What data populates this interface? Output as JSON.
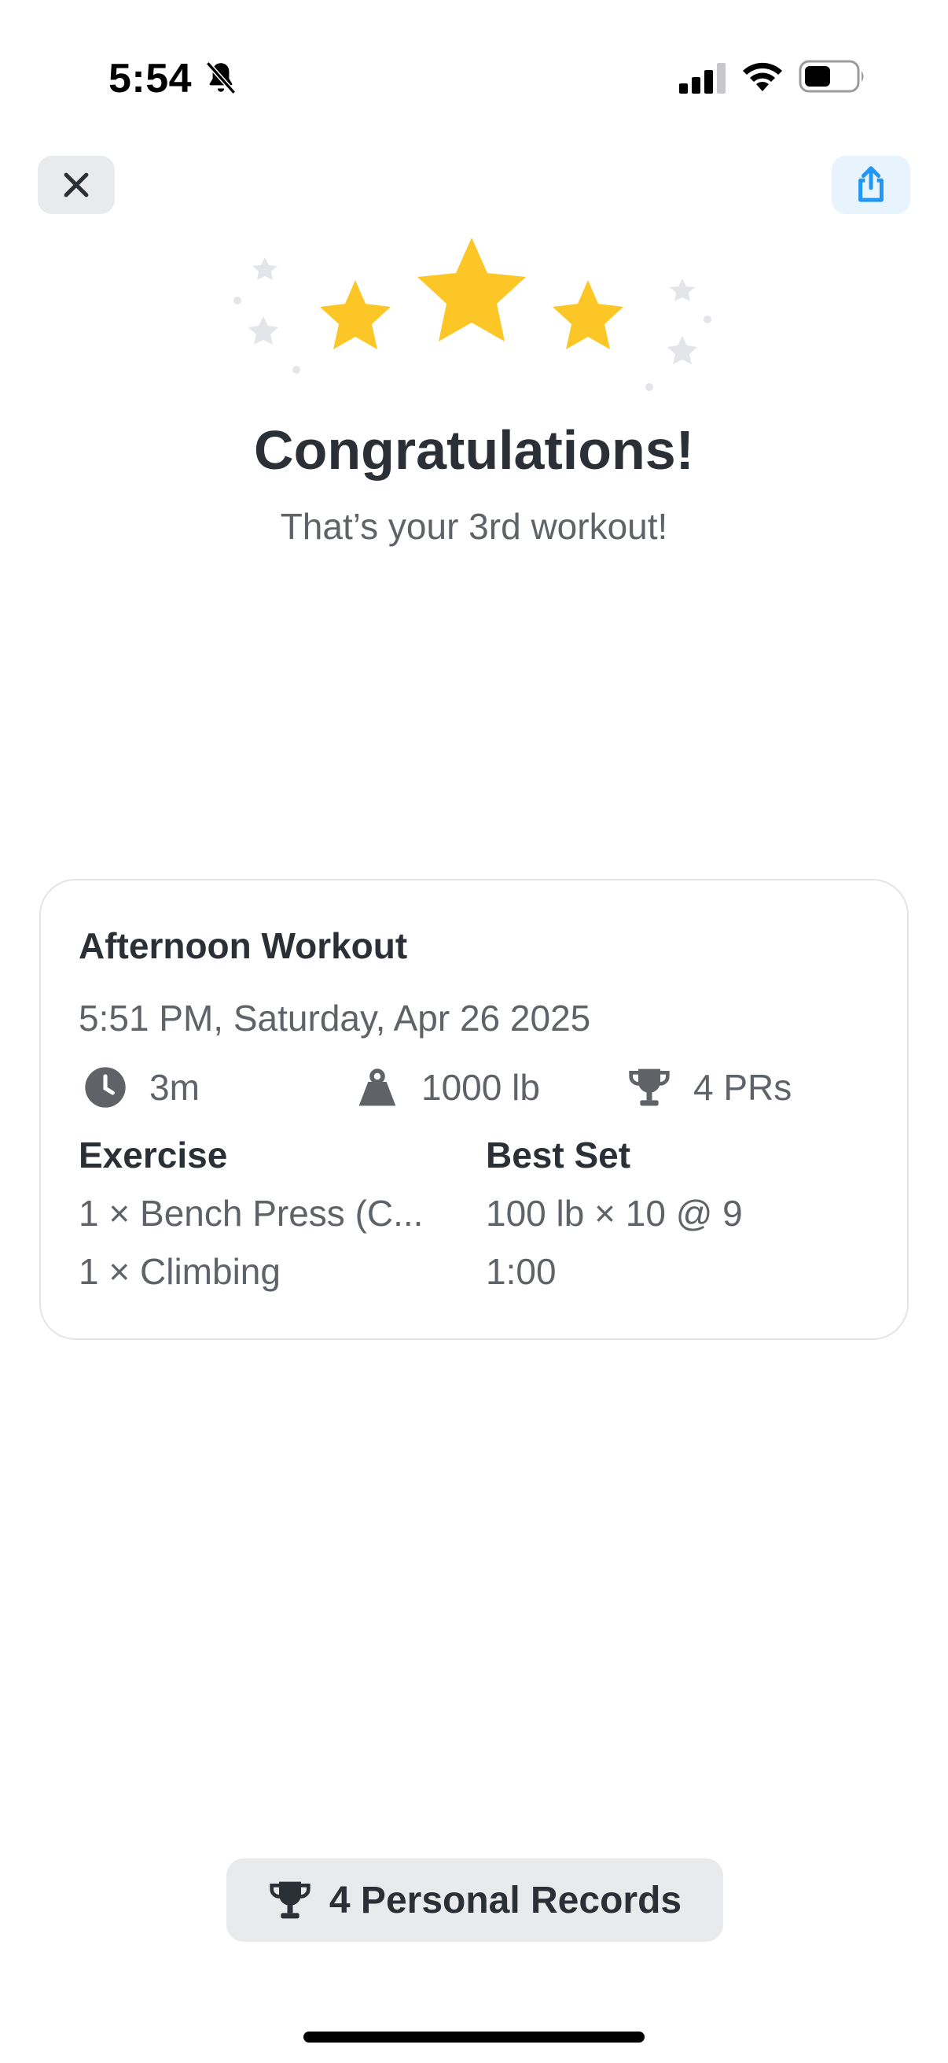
{
  "status_bar": {
    "time": "5:54",
    "icons": [
      "bell-slash-icon",
      "cellular-signal-icon",
      "wifi-icon",
      "battery-icon"
    ]
  },
  "toolbar": {
    "close_icon": "close-icon",
    "share_icon": "share-icon",
    "share_color": "#2196f3"
  },
  "header": {
    "title": "Congratulations!",
    "subtitle": "That’s your 3rd workout!",
    "star_color": "#fcc726",
    "sparkle_color": "#e4e5e8"
  },
  "workout": {
    "title": "Afternoon Workout",
    "date": "5:51 PM, Saturday, Apr 26 2025",
    "stats": {
      "duration": "3m",
      "volume": "1000 lb",
      "prs": "4 PRs"
    },
    "columns": {
      "exercise": "Exercise",
      "best_set": "Best Set"
    },
    "rows": [
      {
        "exercise": "1 × Bench Press (C...",
        "best_set": "100 lb × 10 @ 9"
      },
      {
        "exercise": "1 × Climbing",
        "best_set": "1:00"
      }
    ]
  },
  "footer": {
    "pr_label": "4 Personal Records"
  }
}
